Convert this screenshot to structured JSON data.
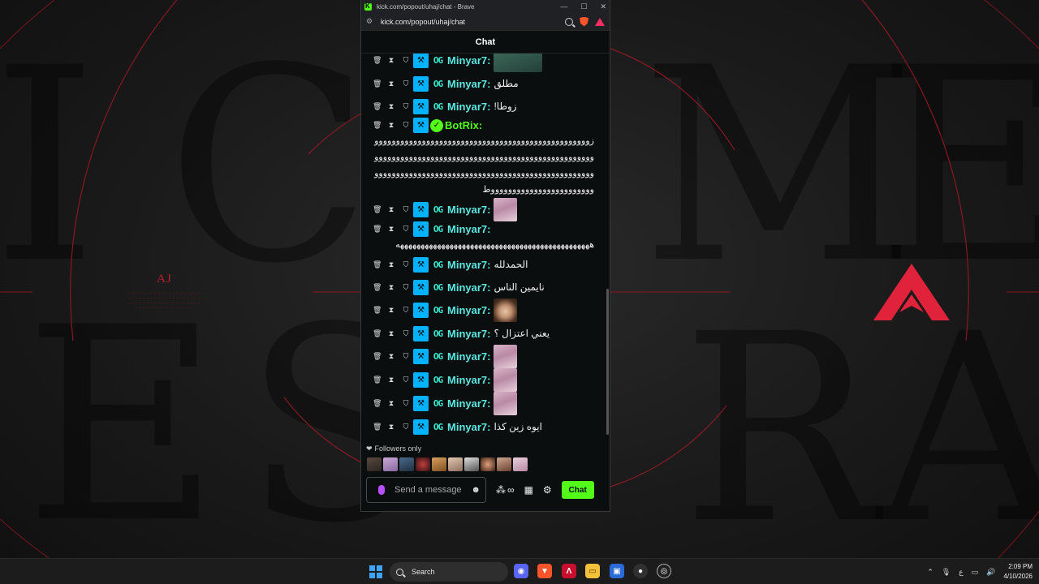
{
  "browser": {
    "window_title": "kick.com/popout/uhaj/chat - Brave",
    "url": "kick.com/popout/uhaj/chat",
    "minimize_icon": "minimize-icon",
    "maximize_icon": "maximize-icon",
    "close_icon": "close-icon"
  },
  "chat": {
    "header": "Chat",
    "messages": [
      {
        "user": "Minyar7:",
        "text": "",
        "emote": "green"
      },
      {
        "user": "Minyar7:",
        "text": "مطلق"
      },
      {
        "user": "Minyar7:",
        "text": "زوطا!"
      },
      {
        "user": "BotRix:",
        "long": "زووووووووووووووووووووووووووووووووووووووووووووووووووووووووووووووووووووووووووووووووووووووووووووووووووووووووووووووووووووووووووووووووووووووووووووووووووووووووووووووووووووووووووووووووط"
      },
      {
        "user": "Minyar7:",
        "text": "",
        "emote": "pink"
      },
      {
        "user": "Minyar7:",
        "long": "هههههههههههههههههههههههههههههههههههههههههههههههه"
      },
      {
        "user": "Minyar7:",
        "text": "الحمدلله"
      },
      {
        "user": "Minyar7:",
        "text": "نايمين الناس"
      },
      {
        "user": "Minyar7:",
        "text": "",
        "emote": "baby"
      },
      {
        "user": "Minyar7:",
        "text": "يعني اعتزال ؟"
      },
      {
        "user": "Minyar7:",
        "text": "",
        "emote": "pink"
      },
      {
        "user": "Minyar7:",
        "text": "",
        "emote": "pink"
      },
      {
        "user": "Minyar7:",
        "text": "",
        "emote": "pink"
      },
      {
        "user": "Minyar7:",
        "text": "ايوه زين كذا"
      }
    ],
    "followers_only": "Followers only",
    "input_placeholder": "Send a message",
    "send_button": "Chat",
    "infinity_symbol": "∞"
  },
  "wallpaper": {
    "logo": "AJ"
  },
  "taskbar": {
    "search_label": "Search",
    "time": "2:09 PM",
    "date": "4/10/2026",
    "lang": "ع"
  },
  "colors": {
    "kick_green": "#53fc18",
    "username_cyan": "#5ce8e0",
    "accent_red": "#c8102e"
  }
}
